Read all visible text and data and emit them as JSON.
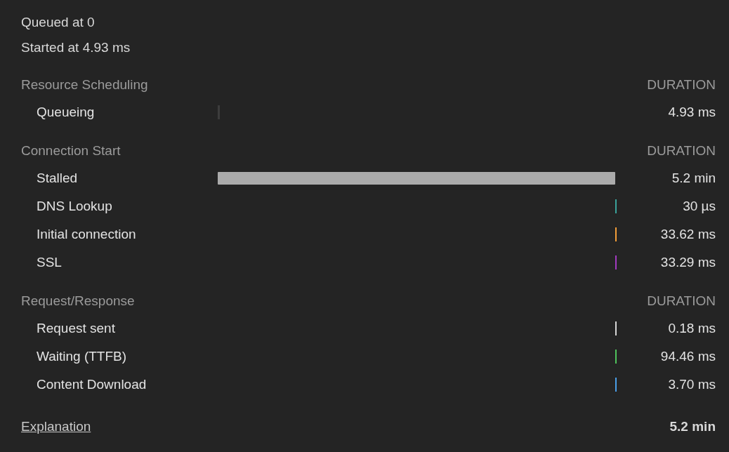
{
  "queued_at": "Queued at 0",
  "started_at": "Started at 4.93 ms",
  "sections": [
    {
      "title": "Resource Scheduling",
      "column": "DURATION",
      "rows": [
        {
          "label": "Queueing",
          "kind": "start",
          "color": "#3c3c3c",
          "duration": "4.93 ms"
        }
      ]
    },
    {
      "title": "Connection Start",
      "column": "DURATION",
      "rows": [
        {
          "label": "Stalled",
          "kind": "full",
          "color": "#ababab",
          "duration": "5.2 min"
        },
        {
          "label": "DNS Lookup",
          "kind": "end",
          "color": "#3aa39b",
          "duration": "30 µs"
        },
        {
          "label": "Initial connection",
          "kind": "end",
          "color": "#f29d38",
          "duration": "33.62 ms"
        },
        {
          "label": "SSL",
          "kind": "end",
          "color": "#a23ac0",
          "duration": "33.29 ms"
        }
      ]
    },
    {
      "title": "Request/Response",
      "column": "DURATION",
      "rows": [
        {
          "label": "Request sent",
          "kind": "end",
          "color": "#d6d6d6",
          "duration": "0.18 ms"
        },
        {
          "label": "Waiting (TTFB)",
          "kind": "end",
          "color": "#4fc35c",
          "duration": "94.46 ms"
        },
        {
          "label": "Content Download",
          "kind": "end",
          "color": "#4a9fe8",
          "duration": "3.70 ms"
        }
      ]
    }
  ],
  "footer": {
    "link": "Explanation",
    "total": "5.2 min"
  }
}
